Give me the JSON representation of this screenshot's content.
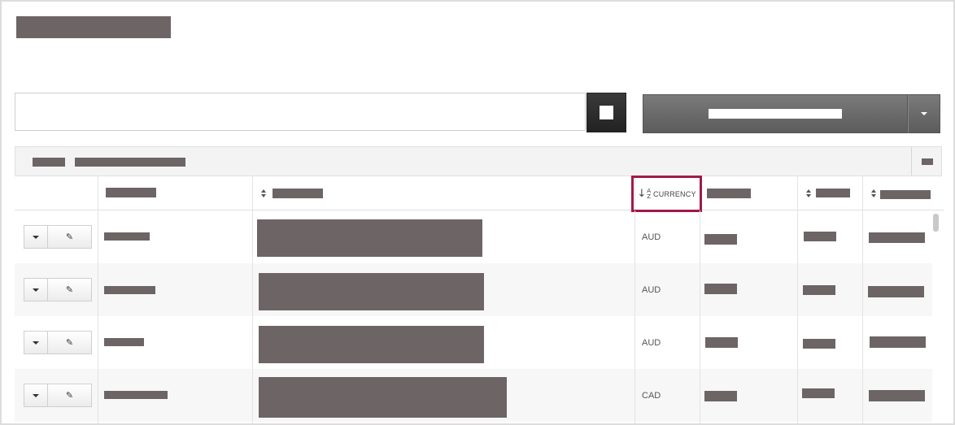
{
  "table": {
    "columns": {
      "currency": {
        "label": "CURRENCY",
        "sort": "ascending"
      }
    },
    "rows": [
      {
        "currency": "AUD"
      },
      {
        "currency": "AUD"
      },
      {
        "currency": "AUD"
      },
      {
        "currency": "CAD"
      }
    ]
  },
  "icons": {
    "search": "square-icon",
    "sort": "sort-icon",
    "sort_active": "sort-alpha-asc-icon",
    "row_menu": "caret-down-icon",
    "row_edit": "pencil-icon",
    "collapse": "minus-icon"
  },
  "colors": {
    "highlight_border": "#a01a4a",
    "redaction": "#6d6466",
    "primary_button": "#6a6a6a",
    "search_button": "#2a2a2a"
  }
}
